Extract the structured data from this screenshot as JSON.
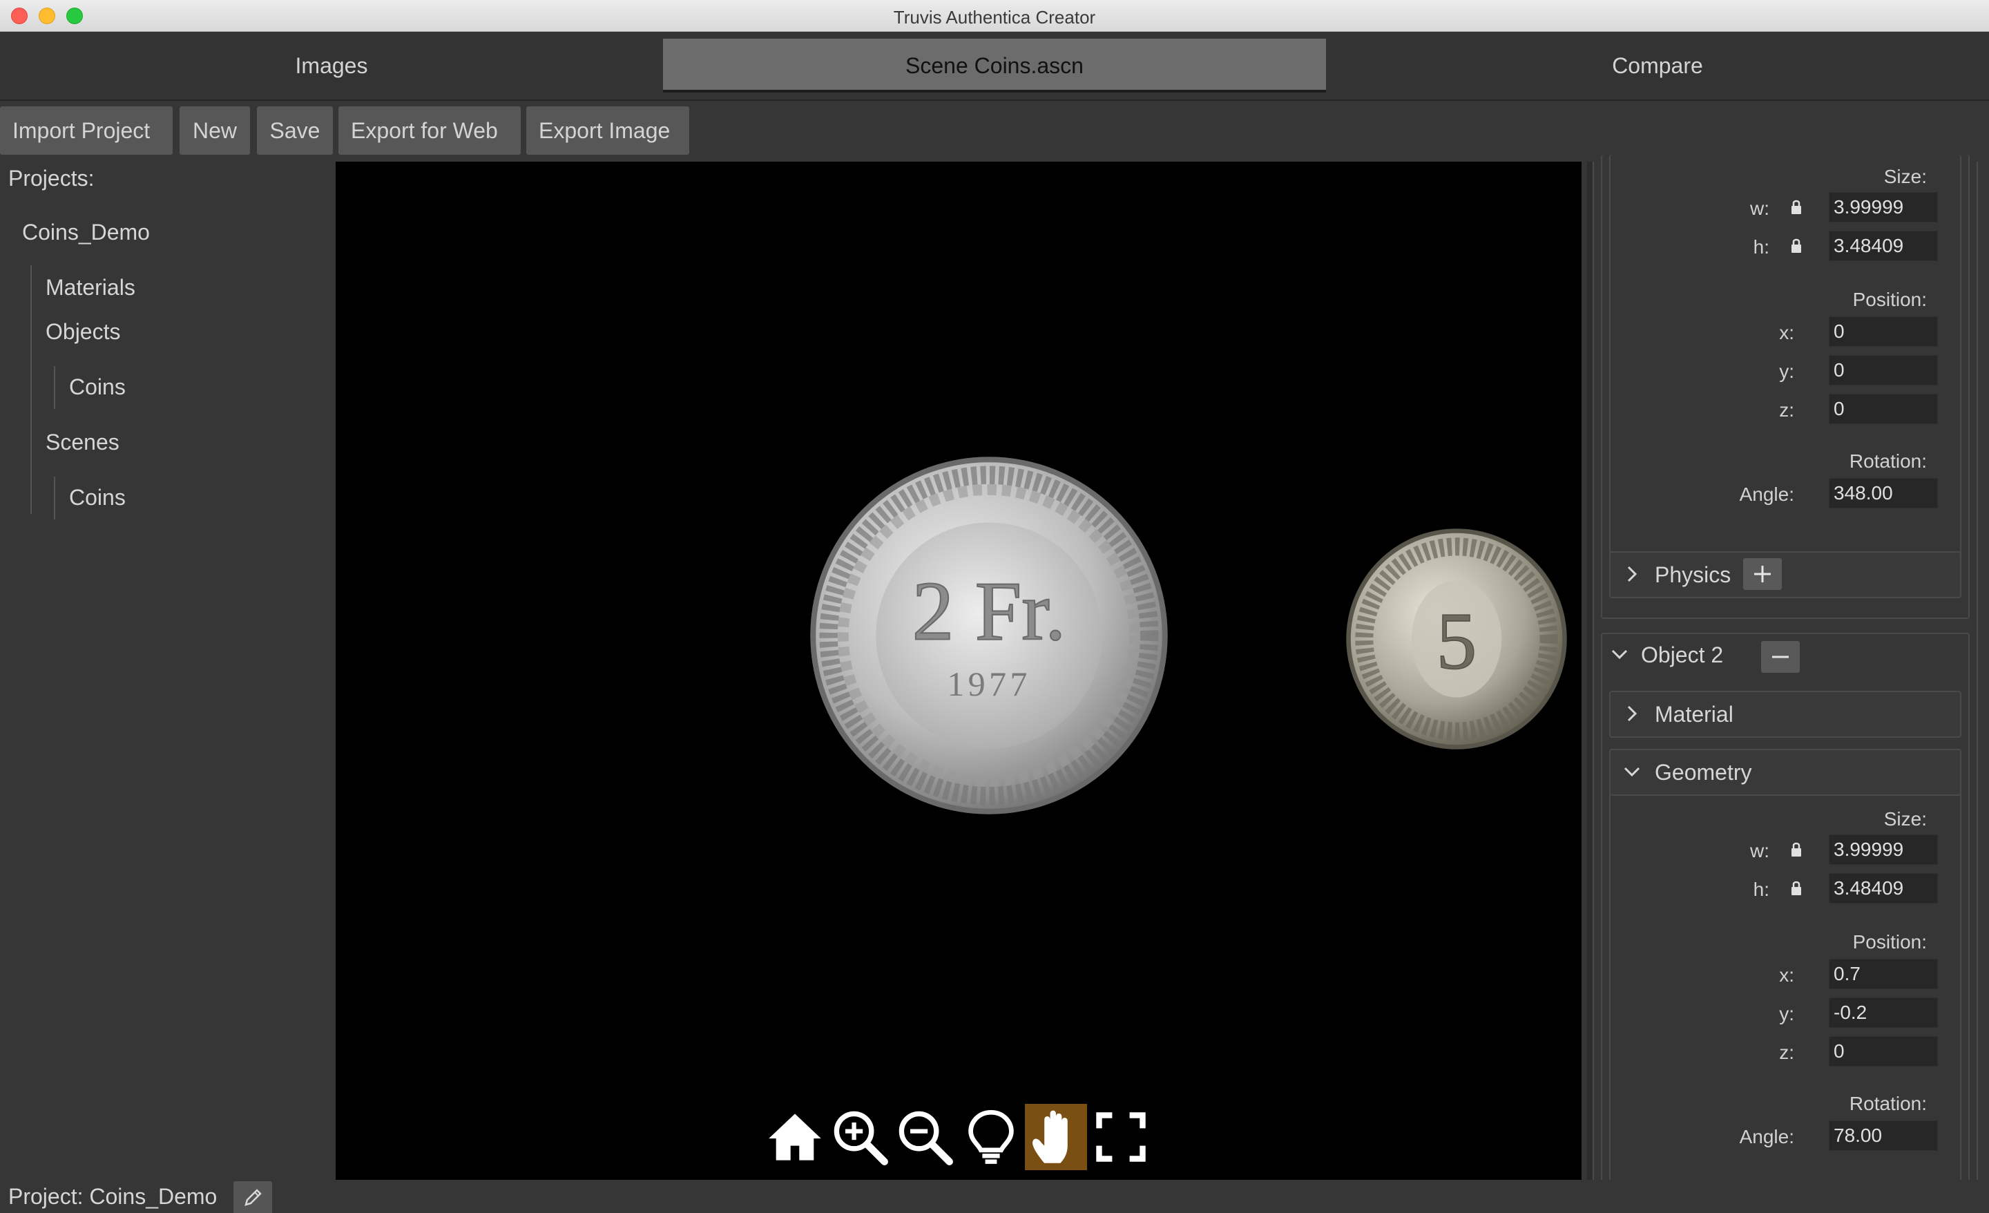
{
  "window": {
    "title": "Truvis Authentica Creator"
  },
  "tabs": [
    {
      "label": "Images"
    },
    {
      "label": "Scene Coins.ascn"
    },
    {
      "label": "Compare"
    }
  ],
  "toolbar": {
    "import_label": "Import Project",
    "new_label": "New",
    "save_label": "Save",
    "export_web_label": "Export for Web",
    "export_image_label": "Export Image"
  },
  "sidebar": {
    "heading": "Projects:",
    "project": "Coins_Demo",
    "materials": "Materials",
    "objects": "Objects",
    "objects_child": "Coins",
    "scenes": "Scenes",
    "scenes_child": "Coins"
  },
  "viewport": {
    "coin_big": {
      "value": "2 Fr.",
      "year": "1977"
    },
    "coin_small": {
      "value": "5"
    },
    "tools": [
      "home-icon",
      "zoom-in-icon",
      "zoom-out-icon",
      "lightbulb-icon",
      "hand-pan-icon",
      "fullscreen-icon"
    ],
    "active_tool_color": "#7a4f14"
  },
  "object1": {
    "geometry": {
      "size_label": "Size:",
      "w_label": "w:",
      "w": "3.99999",
      "h_label": "h:",
      "h": "3.48409",
      "position_label": "Position:",
      "x_label": "x:",
      "x": "0",
      "y_label": "y:",
      "y": "0",
      "z_label": "z:",
      "z": "0",
      "rotation_label": "Rotation:",
      "angle_label": "Angle:",
      "angle": "348.00"
    },
    "physics_label": "Physics"
  },
  "object2": {
    "title": "Object 2",
    "material_label": "Material",
    "geometry_label": "Geometry",
    "geometry": {
      "size_label": "Size:",
      "w_label": "w:",
      "w": "3.99999",
      "h_label": "h:",
      "h": "3.48409",
      "position_label": "Position:",
      "x_label": "x:",
      "x": "0.7",
      "y_label": "y:",
      "y": "-0.2",
      "z_label": "z:",
      "z": "0",
      "rotation_label": "Rotation:",
      "angle_label": "Angle:",
      "angle": "78.00"
    }
  },
  "status": {
    "text": "Project: Coins_Demo"
  }
}
